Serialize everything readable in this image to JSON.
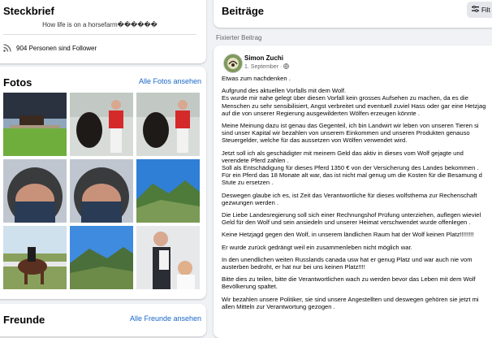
{
  "steckbrief": {
    "title": "Steckbrief",
    "bio": "How life is on a horsefarm������",
    "followers": "904 Personen sind Follower"
  },
  "fotos": {
    "title": "Fotos",
    "link": "Alle Fotos ansehen"
  },
  "freunde": {
    "title": "Freunde",
    "link": "Alle Freunde ansehen"
  },
  "beitraege": {
    "title": "Beiträge",
    "filter_label": "Filt",
    "pinned_label": "Fixierter Beitrag"
  },
  "post": {
    "author": "Simon Zuchi",
    "date": "1. September · ",
    "paragraphs": [
      "Etwas zum nachdenken .",
      "Aufgrund des aktuellen Vorfalls mit dem Wolf.\nEs wurde mir nahe gelegt über diesen Vorfall kein grosses Aufsehen zu machen, da es die\nMenschen zu sehr sensibilisiert, Angst verbreitet und eventuell zuviel Hass oder gar eine Hetzjag\nauf die von unserer Regierung ausgewilderten Wölfen erzeugen könnte .",
      "Meine Meinung dazu ist genau das Gegenteil, ich bin Landwirt wir leben von unseren Tieren si\nsind unser Kapital wir bezahlen von unserem Einkommen und unseren Produkten genauso\nSteuergelder, welche für das aussetzen von Wölfen verwendet wird.",
      "Jetzt soll ich als geschädigter mit meinem Geld das aktiv in dieses vom Wolf gejagte und\nverendete Pferd zahlen .\nSoll als Entschädigung für dieses Pferd 1350 € von der Versicherung des Landes bekommen .\nFür ein Pferd das 18 Monate alt war, das ist nicht mal genug um die Kosten für die Besamung d\nStute zu ersetzen .",
      "Deswegen glaube ich es, ist Zeit das Verantwortliche für dieses wolfsthema zur Rechenschaft\ngezwungen werden .",
      "Die Liebe Landesregierung soll sich einer Rechnungshof Prüfung unterziehen, auflegen wieviel\nGeld für den Wolf und sein ansiedeln und unserer Heimat verschwendet wurde offenlegen .",
      "Keine Hetzjagd gegen den Wolf, in unserem ländlichen Raum hat der Wolf keinen Platz!!!!!!!!",
      "Er wurde zurück gedrängt weil ein zusammenleben nicht möglich war.",
      "In den unendlichen weiten Russlands canada usw hat er genug Platz und war auch nie vom\nausterben bedroht, er hat nur bei uns keinen Platz!!!!",
      "Bitte dies zu teilen, bitte die Verantwortlichen wach zu werden bevor das Leben mit dem Wolf\nBevölkerung spaltet.",
      "Wir bezahlen unsere Politiker, sie sind unsere Angestellten und deswegen gehören sie jetzt mi\nallen Mitteln zur Verantwortung gezogen ."
    ]
  },
  "colors": {
    "link": "#1a66c9",
    "background": "#f0f2f5",
    "card": "#ffffff"
  }
}
